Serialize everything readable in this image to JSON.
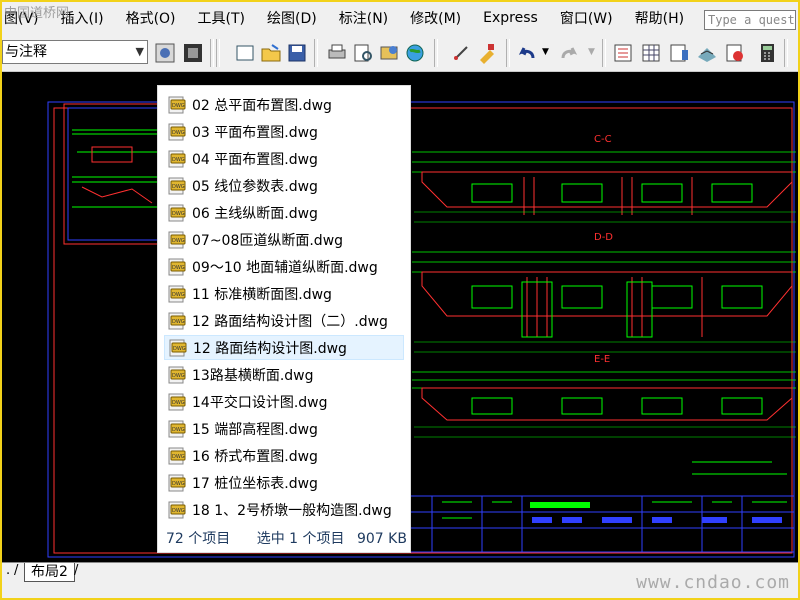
{
  "watermark_top": "中国道桥网",
  "watermark_bottom": "www.cndao.com",
  "menu": [
    "图(V)",
    "插入(I)",
    "格式(O)",
    "工具(T)",
    "绘图(D)",
    "标注(N)",
    "修改(M)",
    "Express",
    "窗口(W)",
    "帮助(H)"
  ],
  "search_placeholder": "Type a quest",
  "toolbar": {
    "style_value": "与注释"
  },
  "files": [
    "02 总平面布置图.dwg",
    "03 平面布置图.dwg",
    "04 平面布置图.dwg",
    "05 线位参数表.dwg",
    "06 主线纵断面.dwg",
    "07~08匝道纵断面.dwg",
    "09～10 地面辅道纵断面.dwg",
    "11 标准横断面图.dwg",
    "12 路面结构设计图（二）.dwg",
    "12 路面结构设计图.dwg",
    "13路基横断面.dwg",
    "14平交口设计图.dwg",
    "15 端部高程图.dwg",
    "16 桥式布置图.dwg",
    "17 桩位坐标表.dwg",
    "18 1、2号桥墩一般构造图.dwg"
  ],
  "selected_index": 9,
  "status": {
    "count": "72 个项目",
    "selected": "选中 1 个项目",
    "size": "907 KB"
  },
  "layout_tab": "布局2",
  "drawing_labels": [
    "C-C",
    "D-D",
    "E-E"
  ],
  "colors": {
    "drawing_bg": "#000000",
    "line_green": "#00ff00",
    "line_red": "#ff3030",
    "line_blue": "#3040ff",
    "frame": "#f2d21a"
  }
}
